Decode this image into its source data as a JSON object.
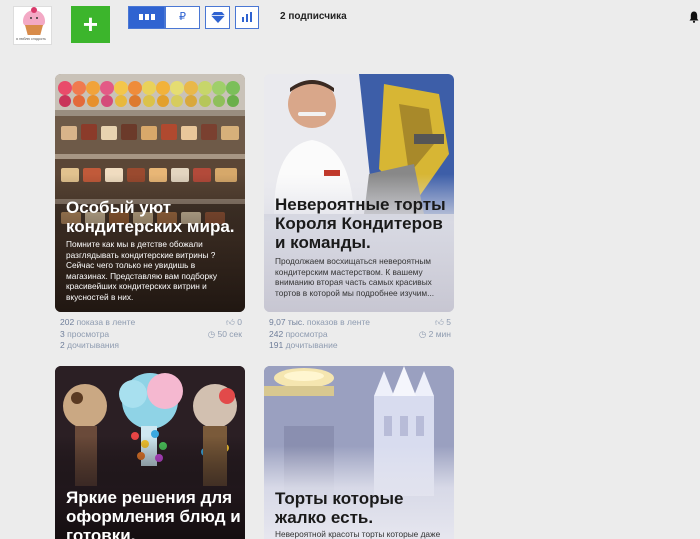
{
  "header": {
    "avatar_caption": "я люблю сладость",
    "add_label": "+",
    "ruble_label": "₽",
    "subscribers": "2 подписчика"
  },
  "cards": [
    {
      "title": "Особый уют кондитерских мира.",
      "desc": "Помните как мы в детстве обожали разглядывать кондитерские витрины ? Сейчас чего только не увидишь в магазинах. Представляю вам подборку красивейших кондитерских витрин и вкусностей в них.",
      "stats": {
        "impressions_value": "202",
        "impressions_label": "показа в ленте",
        "views_value": "3",
        "views_label": "просмотра",
        "reads_value": "2",
        "reads_label": "дочитывания",
        "likes": "0",
        "time": "50 сек"
      }
    },
    {
      "title": "Невероятные торты Короля Кондитеров и команды.",
      "desc": "Продолжаем восхищаться невероятным кондитерским мастерством. К вашему вниманию вторая часть самых красивых тортов в которой мы подробнее изучим...",
      "stats": {
        "impressions_value": "9,07 тыс.",
        "impressions_label": "показов в ленте",
        "views_value": "242",
        "views_label": "просмотра",
        "reads_value": "191",
        "reads_label": "дочитывание",
        "likes": "5",
        "time": "2 мин"
      }
    },
    {
      "title": "Яркие решения для оформления блюд и готовки.",
      "desc": ""
    },
    {
      "title": "Торты которые жалко есть.",
      "desc": "Невероятной красоты торты которые даже"
    }
  ],
  "colors": {
    "accent_blue": "#2f63d1",
    "add_green": "#3cb52c",
    "background": "#ececec"
  }
}
